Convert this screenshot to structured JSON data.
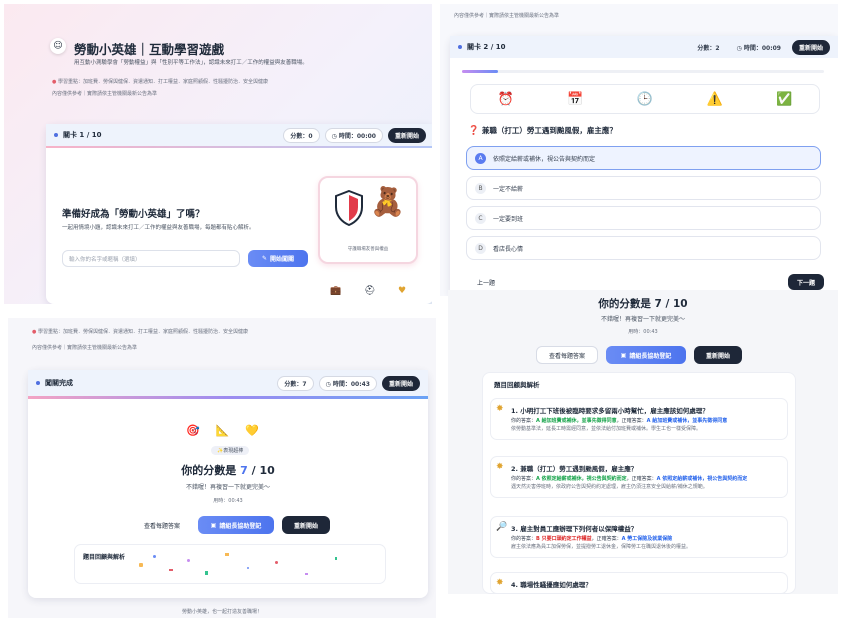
{
  "panelA": {
    "title": "勞動小英雄｜互動學習遊戲",
    "subtitle": "用互動小測驗學會「勞動權益」與「性別平等工作法」，認識未來打工／工作的權益與友善職場。",
    "topics": "學習重點：加班費．勞保與健保．資遣通知．打工權益．家庭照顧假．性騷擾防治．安全與健康",
    "note": "內容僅供參考｜實際請依主管機關最新公告為準",
    "level_label": "關卡 1 / 10",
    "score": "分數：0",
    "time": "時間：00:00",
    "restart": "重新開始",
    "hero_title": "準備好成為「勞動小英雄」了嗎？",
    "hero_desc": "一起用情境小題，認識未來打工／工作的權益與友善職場，每題都有貼心解析。",
    "name_placeholder": "輸入你的名字或暱稱（選填）",
    "start_button": "開始闖關",
    "badge_caption": "守護職場友善與權益"
  },
  "panelB": {
    "top_note": "內容僅供參考｜實際請依主管機關最新公告為準",
    "level_label": "關卡 2 / 10",
    "score": "分數：2",
    "time": "時間：00:09",
    "restart": "重新開始",
    "progress": 0.1,
    "question": "兼職（打工）勞工遇到颱風假，雇主應？",
    "options": [
      {
        "letter": "A",
        "text": "依照定給薪或補休，視公告與契約而定"
      },
      {
        "letter": "B",
        "text": "一定不給薪"
      },
      {
        "letter": "C",
        "text": "一定要到班"
      },
      {
        "letter": "D",
        "text": "看店長心情"
      }
    ],
    "prev": "上一題",
    "next": "下一題"
  },
  "panelC": {
    "topics": "學習重點：加班費．勞保與健保．資遣通知．打工權益．家庭照顧假．性騷擾防治．安全與健康",
    "note": "內容僅供參考｜實際請依主管機關最新公告為準",
    "level_label": "闖關完成",
    "score": "分數：7",
    "time": "時間：00:43",
    "restart": "重新開始",
    "tag": "表現超棒",
    "score_prefix": "你的分數是",
    "score_value": "7",
    "score_total": "/ 10",
    "encourage": "不錯喔！再複習一下就更完美～",
    "elapsed": "用時：00:43",
    "view_answers": "查看每題答案",
    "request_help": "請組長協助登記",
    "restart2": "重新開始",
    "review_heading": "題目回顧與解析",
    "footer": "勞動小英雄，也一起打造友善職場！"
  },
  "panelD": {
    "score_prefix": "你的分數是",
    "score_value": "7",
    "score_total": "/ 10",
    "encourage": "不錯喔！再複習一下就更完美～",
    "elapsed": "用時：00:43",
    "view_answers": "查看每題答案",
    "request_help": "請組長協助登記",
    "restart": "重新開始",
    "review_heading": "題目回顧與解析",
    "items": [
      {
        "q": "1. 小明打工下班後被臨時要求多留兩小時幫忙，雇主應該如何處理？",
        "yours_label": "你的答案：",
        "yours": "A 給加班費或補休，並事先徵得同意",
        "correct_label": "正確答案：",
        "correct": "A 給加班費或補休，並事先徵得同意",
        "expl": "依勞動基準法，延長工時需經同意，並依法給付加班費或補休。學生工也一樣受保障。"
      },
      {
        "q": "2. 兼職（打工）勞工遇到颱風假，雇主應？",
        "yours_label": "你的答案：",
        "yours": "A 依照定給薪或補休，視公告與契約而定",
        "correct_label": "正確答案：",
        "correct": "A 依照定給薪或補休，視公告與契約而定",
        "expl": "遇天然災害停班時，依政府公告與契約約定處理，雇主仍須注意安全與給薪/補休之規範。"
      },
      {
        "q": "3. 雇主對員工應辦理下列何者以保障權益？",
        "yours_label": "你的答案：",
        "yours": "B 只要口頭約定工作權益",
        "correct_label": "正確答案：",
        "correct": "A 勞工保險及就業保險",
        "expl": "雇主依法應為員工加保勞保，並提撥勞工退休金，保障勞工在職與退休後的權益。"
      },
      {
        "q": "4. 職場性騷擾應如何處理？",
        "yours_label": "",
        "yours": "",
        "correct_label": "",
        "correct": "",
        "expl": ""
      }
    ]
  }
}
